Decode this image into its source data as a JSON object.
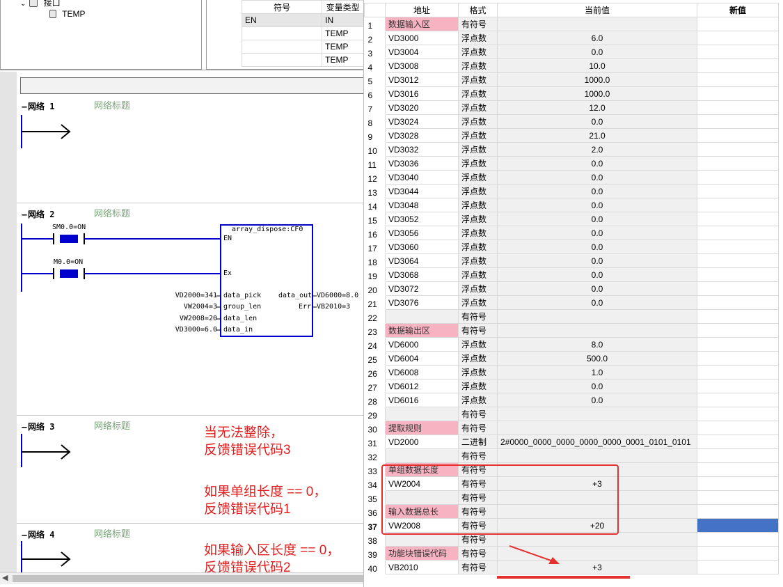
{
  "tree": {
    "interface_label": "接口",
    "temp_label": "TEMP"
  },
  "interface_table": {
    "headers": [
      "符号",
      "变量类型"
    ],
    "rows": [
      {
        "symbol": "EN",
        "type": "IN"
      },
      {
        "symbol": "",
        "type": "TEMP"
      },
      {
        "symbol": "",
        "type": "TEMP"
      },
      {
        "symbol": "",
        "type": "TEMP"
      }
    ]
  },
  "networks": [
    {
      "label": "网络",
      "num": "1",
      "title": "网络标题"
    },
    {
      "label": "网络",
      "num": "2",
      "title": "网络标题"
    },
    {
      "label": "网络",
      "num": "3",
      "title": "网络标题"
    },
    {
      "label": "网络",
      "num": "4",
      "title": "网络标题"
    }
  ],
  "network2": {
    "contact1_label": "SM0.0=ON",
    "contact2_label": "M0.0=ON",
    "block_name": "array_dispose:CF0",
    "pin_en": "EN",
    "pin_ex": "Ex",
    "pin_data_pick": "data_pick",
    "pin_group_len": "group_len",
    "pin_data_len": "data_len",
    "pin_data_in": "data_in",
    "pin_data_out": "data_out",
    "pin_err": "Err",
    "in_data_pick": "VD2000=341",
    "in_group_len": "VW2004=3",
    "in_data_len": "VW2008=20",
    "in_data_in": "VD3000=6.0",
    "out_data_out": "VD6000=8.0",
    "out_err": "VB2010=3"
  },
  "notes": {
    "note1_line1": "当无法整除，",
    "note1_line2": "反馈错误代码3",
    "note2_line1": "如果单组长度 == 0，",
    "note2_line2": "反馈错误代码1",
    "note3_line1": "如果输入区长度 == 0，",
    "note3_line2": "反馈错误代码2"
  },
  "status_chart": {
    "headers": {
      "num": "",
      "address": "地址",
      "format": "格式",
      "current": "当前值",
      "new": "新值"
    },
    "rows": [
      {
        "n": "1",
        "addr": "数据输入区",
        "fmt": "有符号",
        "cur": "",
        "kind": "section"
      },
      {
        "n": "2",
        "addr": "VD3000",
        "fmt": "浮点数",
        "cur": "6.0"
      },
      {
        "n": "3",
        "addr": "VD3004",
        "fmt": "浮点数",
        "cur": "0.0"
      },
      {
        "n": "4",
        "addr": "VD3008",
        "fmt": "浮点数",
        "cur": "10.0"
      },
      {
        "n": "5",
        "addr": "VD3012",
        "fmt": "浮点数",
        "cur": "1000.0"
      },
      {
        "n": "6",
        "addr": "VD3016",
        "fmt": "浮点数",
        "cur": "1000.0"
      },
      {
        "n": "7",
        "addr": "VD3020",
        "fmt": "浮点数",
        "cur": "12.0"
      },
      {
        "n": "8",
        "addr": "VD3024",
        "fmt": "浮点数",
        "cur": "0.0"
      },
      {
        "n": "9",
        "addr": "VD3028",
        "fmt": "浮点数",
        "cur": "21.0"
      },
      {
        "n": "10",
        "addr": "VD3032",
        "fmt": "浮点数",
        "cur": "2.0"
      },
      {
        "n": "11",
        "addr": "VD3036",
        "fmt": "浮点数",
        "cur": "0.0"
      },
      {
        "n": "12",
        "addr": "VD3040",
        "fmt": "浮点数",
        "cur": "0.0"
      },
      {
        "n": "13",
        "addr": "VD3044",
        "fmt": "浮点数",
        "cur": "0.0"
      },
      {
        "n": "14",
        "addr": "VD3048",
        "fmt": "浮点数",
        "cur": "0.0"
      },
      {
        "n": "15",
        "addr": "VD3052",
        "fmt": "浮点数",
        "cur": "0.0"
      },
      {
        "n": "16",
        "addr": "VD3056",
        "fmt": "浮点数",
        "cur": "0.0"
      },
      {
        "n": "17",
        "addr": "VD3060",
        "fmt": "浮点数",
        "cur": "0.0"
      },
      {
        "n": "18",
        "addr": "VD3064",
        "fmt": "浮点数",
        "cur": "0.0"
      },
      {
        "n": "19",
        "addr": "VD3068",
        "fmt": "浮点数",
        "cur": "0.0"
      },
      {
        "n": "20",
        "addr": "VD3072",
        "fmt": "浮点数",
        "cur": "0.0"
      },
      {
        "n": "21",
        "addr": "VD3076",
        "fmt": "浮点数",
        "cur": "0.0"
      },
      {
        "n": "22",
        "addr": "",
        "fmt": "有符号",
        "cur": "",
        "kind": "blank"
      },
      {
        "n": "23",
        "addr": "数据输出区",
        "fmt": "有符号",
        "cur": "",
        "kind": "section"
      },
      {
        "n": "24",
        "addr": "VD6000",
        "fmt": "浮点数",
        "cur": "8.0"
      },
      {
        "n": "25",
        "addr": "VD6004",
        "fmt": "浮点数",
        "cur": "500.0"
      },
      {
        "n": "26",
        "addr": "VD6008",
        "fmt": "浮点数",
        "cur": "1.0"
      },
      {
        "n": "27",
        "addr": "VD6012",
        "fmt": "浮点数",
        "cur": "0.0"
      },
      {
        "n": "28",
        "addr": "VD6016",
        "fmt": "浮点数",
        "cur": "0.0"
      },
      {
        "n": "29",
        "addr": "",
        "fmt": "有符号",
        "cur": "",
        "kind": "blank"
      },
      {
        "n": "30",
        "addr": "提取规则",
        "fmt": "有符号",
        "cur": "",
        "kind": "section"
      },
      {
        "n": "31",
        "addr": "VD2000",
        "fmt": "二进制",
        "cur": "2#0000_0000_0000_0000_0000_0001_0101_0101",
        "align": "left"
      },
      {
        "n": "32",
        "addr": "",
        "fmt": "有符号",
        "cur": "",
        "kind": "blank"
      },
      {
        "n": "33",
        "addr": "单组数据长度",
        "fmt": "有符号",
        "cur": "",
        "kind": "section"
      },
      {
        "n": "34",
        "addr": "VW2004",
        "fmt": "有符号",
        "cur": "+3"
      },
      {
        "n": "35",
        "addr": "",
        "fmt": "有符号",
        "cur": "",
        "kind": "blank"
      },
      {
        "n": "36",
        "addr": "输入数据总长",
        "fmt": "有符号",
        "cur": "",
        "kind": "section"
      },
      {
        "n": "37",
        "addr": "VW2008",
        "fmt": "有符号",
        "cur": "+20",
        "selected": true
      },
      {
        "n": "38",
        "addr": "",
        "fmt": "有符号",
        "cur": "",
        "kind": "blank"
      },
      {
        "n": "39",
        "addr": "功能块错误代码",
        "fmt": "有符号",
        "cur": "",
        "kind": "section"
      },
      {
        "n": "40",
        "addr": "VB2010",
        "fmt": "有符号",
        "cur": "+3"
      }
    ]
  },
  "colors": {
    "section_pink": "#f7b3c1",
    "selection_blue": "#4472c4",
    "annotation_red": "#e02020",
    "ladder_blue": "#0000cc"
  }
}
